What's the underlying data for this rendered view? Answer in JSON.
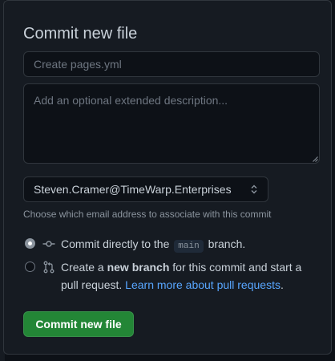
{
  "dialog": {
    "title": "Commit new file",
    "summary": {
      "value": "",
      "placeholder": "Create pages.yml"
    },
    "description": {
      "value": "",
      "placeholder": "Add an optional extended description..."
    },
    "email": {
      "selected": "Steven.Cramer@TimeWarp.Enterprises",
      "hint": "Choose which email address to associate with this commit"
    },
    "options": [
      {
        "selected": true,
        "icon": "git-commit-icon",
        "text_before": "Commit directly to the",
        "branch": "main",
        "text_after": "branch."
      },
      {
        "selected": false,
        "icon": "git-pull-request-icon",
        "text_before": "Create a",
        "bold": "new branch",
        "text_after": "for this commit and start a pull request.",
        "link": "Learn more about pull requests",
        "link_suffix": "."
      }
    ],
    "submit_label": "Commit new file"
  },
  "colors": {
    "background": "#161b22",
    "input_bg": "#0d1117",
    "border": "#30363d",
    "text": "#c9d1d9",
    "muted": "#8b949e",
    "link": "#58a6ff",
    "primary_button": "#238636"
  }
}
